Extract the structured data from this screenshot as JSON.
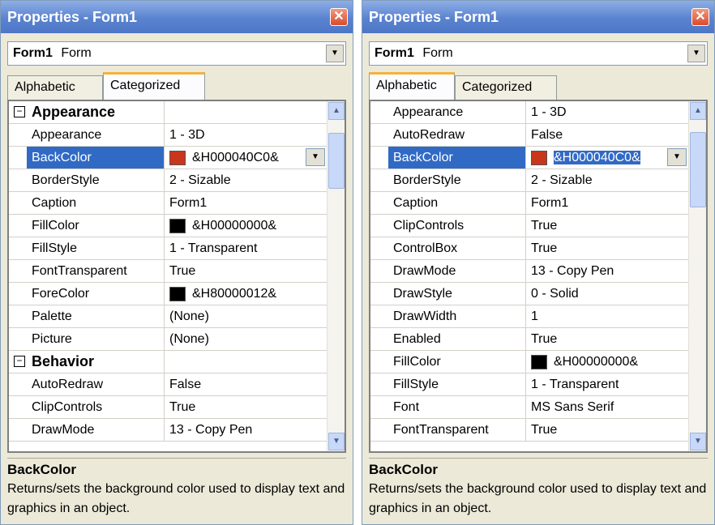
{
  "colors": {
    "titlebar": "#5a83cf",
    "selection": "#316ac5",
    "backcolor_swatch": "#c8361c",
    "black_swatch": "#000000"
  },
  "left": {
    "title": "Properties - Form1",
    "close_icon": "close-icon",
    "object_combo": {
      "name": "Form1",
      "type": "Form"
    },
    "tabs": [
      {
        "label": "Alphabetic"
      },
      {
        "label": "Categorized"
      }
    ],
    "active_tab": "Categorized",
    "rows": [
      {
        "kind": "category",
        "expander": "⊟",
        "name": "Appearance",
        "value": ""
      },
      {
        "kind": "prop",
        "name": "Appearance",
        "value": "1 - 3D"
      },
      {
        "kind": "prop",
        "name": "BackColor",
        "value": "&H000040C0&",
        "swatch": "#c8361c",
        "selected": true,
        "dropdown": true
      },
      {
        "kind": "prop",
        "name": "BorderStyle",
        "value": "2 - Sizable"
      },
      {
        "kind": "prop",
        "name": "Caption",
        "value": "Form1"
      },
      {
        "kind": "prop",
        "name": "FillColor",
        "value": "&H00000000&",
        "swatch": "#000000"
      },
      {
        "kind": "prop",
        "name": "FillStyle",
        "value": "1 - Transparent"
      },
      {
        "kind": "prop",
        "name": "FontTransparent",
        "value": "True"
      },
      {
        "kind": "prop",
        "name": "ForeColor",
        "value": "&H80000012&",
        "swatch": "#000000"
      },
      {
        "kind": "prop",
        "name": "Palette",
        "value": "(None)"
      },
      {
        "kind": "prop",
        "name": "Picture",
        "value": "(None)"
      },
      {
        "kind": "category",
        "expander": "⊟",
        "name": "Behavior",
        "value": ""
      },
      {
        "kind": "prop",
        "name": "AutoRedraw",
        "value": "False"
      },
      {
        "kind": "prop",
        "name": "ClipControls",
        "value": "True"
      },
      {
        "kind": "prop",
        "name": "DrawMode",
        "value": "13 - Copy Pen"
      }
    ],
    "scroll_position": 0.05,
    "scroll_visible_fraction": 0.18,
    "description": {
      "title": "BackColor",
      "text": "Returns/sets the background color used to display text and graphics in an object."
    }
  },
  "right": {
    "title": "Properties - Form1",
    "close_icon": "close-icon",
    "object_combo": {
      "name": "Form1",
      "type": "Form"
    },
    "tabs": [
      {
        "label": "Alphabetic"
      },
      {
        "label": "Categorized"
      }
    ],
    "active_tab": "Alphabetic",
    "rows": [
      {
        "kind": "prop",
        "name": "Appearance",
        "value": "1 - 3D"
      },
      {
        "kind": "prop",
        "name": "AutoRedraw",
        "value": "False"
      },
      {
        "kind": "prop",
        "name": "BackColor",
        "value": "&H000040C0&",
        "swatch": "#c8361c",
        "selected": true,
        "dropdown": true,
        "value_highlight": true
      },
      {
        "kind": "prop",
        "name": "BorderStyle",
        "value": "2 - Sizable"
      },
      {
        "kind": "prop",
        "name": "Caption",
        "value": "Form1"
      },
      {
        "kind": "prop",
        "name": "ClipControls",
        "value": "True"
      },
      {
        "kind": "prop",
        "name": "ControlBox",
        "value": "True"
      },
      {
        "kind": "prop",
        "name": "DrawMode",
        "value": "13 - Copy Pen"
      },
      {
        "kind": "prop",
        "name": "DrawStyle",
        "value": "0 - Solid"
      },
      {
        "kind": "prop",
        "name": "DrawWidth",
        "value": "1"
      },
      {
        "kind": "prop",
        "name": "Enabled",
        "value": "True"
      },
      {
        "kind": "prop",
        "name": "FillColor",
        "value": "&H00000000&",
        "swatch": "#000000"
      },
      {
        "kind": "prop",
        "name": "FillStyle",
        "value": "1 - Transparent"
      },
      {
        "kind": "prop",
        "name": "Font",
        "value": "MS Sans Serif"
      },
      {
        "kind": "prop",
        "name": "FontTransparent",
        "value": "True"
      }
    ],
    "scroll_position": 0.05,
    "scroll_visible_fraction": 0.24,
    "description": {
      "title": "BackColor",
      "text": "Returns/sets the background color used to display text and graphics in an object."
    }
  }
}
